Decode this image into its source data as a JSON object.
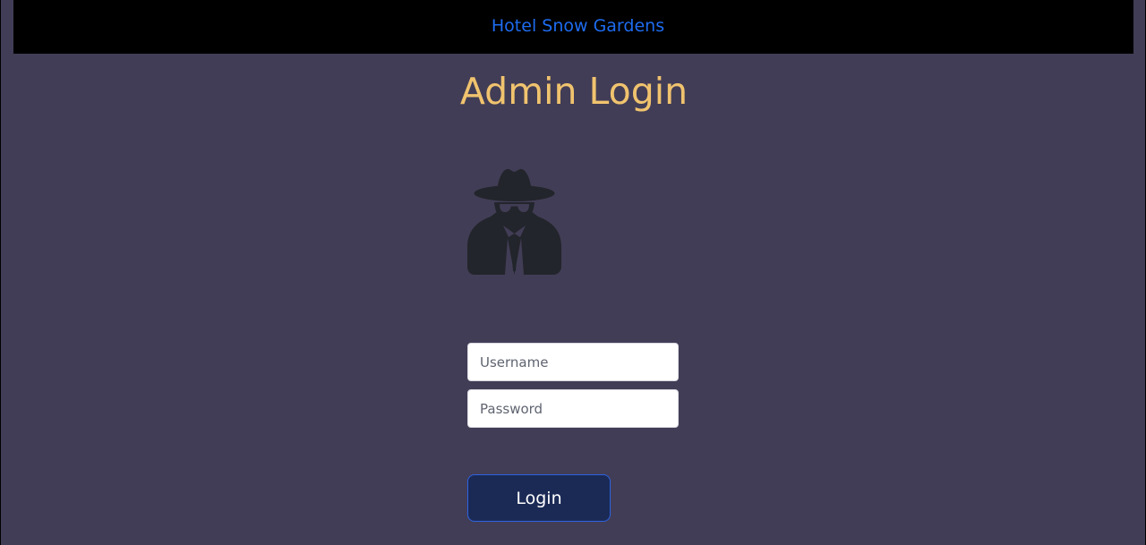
{
  "header": {
    "site_name": "Hotel Snow Gardens"
  },
  "main": {
    "title": "Admin Login",
    "icon": "user-secret-icon",
    "username_placeholder": "Username",
    "password_placeholder": "Password",
    "login_label": "Login"
  },
  "colors": {
    "background": "#423d56",
    "header_background": "#000000",
    "site_link": "#1e6cf0",
    "title": "#f0c36e",
    "icon": "#22252b",
    "button_background": "#1b2a55",
    "button_border": "#2d63e0"
  }
}
